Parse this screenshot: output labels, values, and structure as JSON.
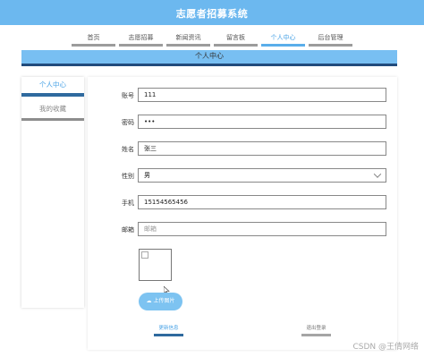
{
  "header": {
    "title": "志愿者招募系统"
  },
  "nav": {
    "tabs": [
      {
        "label": "首页",
        "active": false
      },
      {
        "label": "志愿招募",
        "active": false
      },
      {
        "label": "新闻资讯",
        "active": false
      },
      {
        "label": "留言板",
        "active": false
      },
      {
        "label": "个人中心",
        "active": true
      },
      {
        "label": "后台管理",
        "active": false
      }
    ]
  },
  "section": {
    "title": "个人中心"
  },
  "sidebar": {
    "items": [
      {
        "label": "个人中心",
        "active": true
      },
      {
        "label": "我的收藏",
        "active": false
      }
    ]
  },
  "form": {
    "account_label": "账号",
    "account_value": "111",
    "password_label": "密码",
    "password_value": "•••",
    "name_label": "姓名",
    "name_value": "张三",
    "gender_label": "性别",
    "gender_value": "男",
    "phone_label": "手机",
    "phone_value": "15154565456",
    "email_label": "邮箱",
    "email_placeholder": "邮箱"
  },
  "upload": {
    "label": "上传图片"
  },
  "actions": {
    "update_label": "更新信息",
    "logout_label": "退出登录"
  },
  "watermark": "CSDN @王倩网络"
}
